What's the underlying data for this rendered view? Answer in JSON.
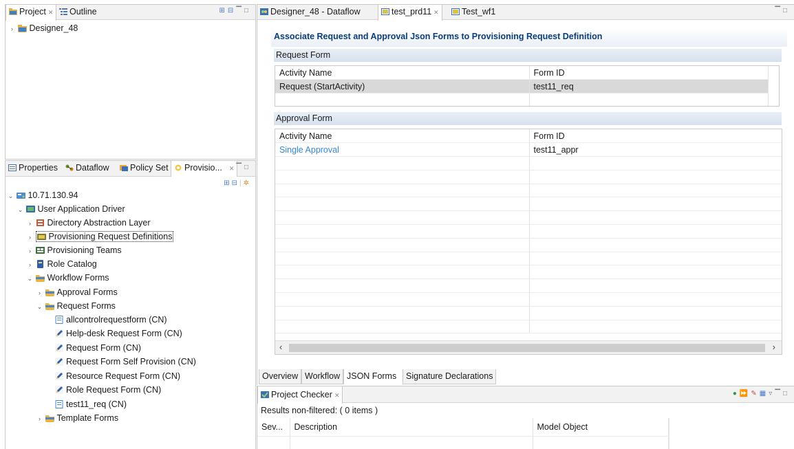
{
  "project_panel": {
    "tabs": [
      "Project",
      "Outline"
    ],
    "tree_root": "Designer_48"
  },
  "modeler_panel": {
    "tabs": [
      "Properties",
      "Dataflow",
      "Policy Set",
      "Provisio..."
    ],
    "tree": [
      {
        "label": "10.71.130.94",
        "icon": "server-icon"
      },
      {
        "label": "User Application Driver",
        "icon": "driver-icon"
      },
      {
        "label": "Directory Abstraction Layer",
        "icon": "dal-icon"
      },
      {
        "label": "Provisioning Request Definitions",
        "icon": "prd-icon"
      },
      {
        "label": "Provisioning Teams",
        "icon": "teams-icon"
      },
      {
        "label": "Role Catalog",
        "icon": "role-catalog-icon"
      },
      {
        "label": "Workflow Forms",
        "icon": "folder-icon"
      },
      {
        "label": "Approval Forms",
        "icon": "folder-icon"
      },
      {
        "label": "Request Forms",
        "icon": "folder-icon"
      },
      {
        "label": "allcontrolrequestform (CN)",
        "icon": "form-icon"
      },
      {
        "label": "Help-desk Request Form (CN)",
        "icon": "form-edit-icon"
      },
      {
        "label": "Request Form (CN)",
        "icon": "form-edit-icon"
      },
      {
        "label": "Request Form Self Provision (CN)",
        "icon": "form-edit-icon"
      },
      {
        "label": "Resource Request Form (CN)",
        "icon": "form-edit-icon"
      },
      {
        "label": "Role Request Form (CN)",
        "icon": "form-edit-icon"
      },
      {
        "label": "test11_req (CN)",
        "icon": "form-icon"
      },
      {
        "label": "Template Forms",
        "icon": "folder-icon"
      }
    ]
  },
  "editor": {
    "tabs": [
      "Designer_48 - Dataflow",
      "test_prd11",
      "Test_wf1"
    ],
    "heading": "Associate Request and Approval Json Forms to Provisioning Request Definition",
    "request_form": {
      "section": "Request Form",
      "columns": [
        "Activity Name",
        "Form ID"
      ],
      "rows": [
        [
          "Request (StartActivity)",
          "test11_req"
        ]
      ]
    },
    "approval_form": {
      "section": "Approval Form",
      "columns": [
        "Activity Name",
        "Form ID"
      ],
      "rows": [
        [
          "Single Approval",
          "test11_appr"
        ]
      ]
    },
    "bottom_tabs": [
      "Overview",
      "Workflow",
      "JSON Forms",
      "Signature Declarations"
    ]
  },
  "checker": {
    "tab": "Project Checker",
    "results": "Results non-filtered: ( 0 items )",
    "columns": [
      "Sev...",
      "Description",
      "Model Object"
    ]
  },
  "colors": {
    "heading": "#0b3e78",
    "link": "#3387d6",
    "selected_row": "#d9d9d9",
    "section_bar": "#dbe4ee"
  }
}
